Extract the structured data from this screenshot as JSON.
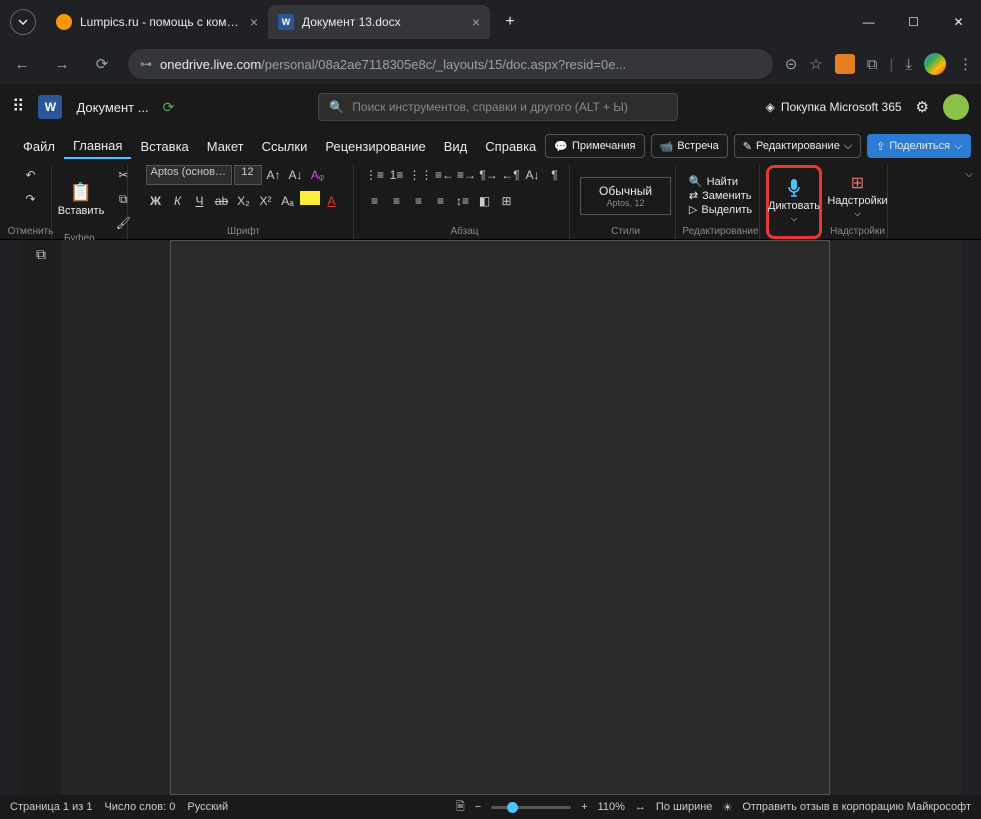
{
  "browser": {
    "tabs": [
      {
        "title": "Lumpics.ru - помощь с компью"
      },
      {
        "title": "Документ 13.docx"
      }
    ],
    "url_host": "onedrive.live.com",
    "url_path": "/personal/08a2ae7118305e8c/_layouts/15/doc.aspx?resid=0e..."
  },
  "app": {
    "doc_name": "Документ ...",
    "search_placeholder": "Поиск инструментов, справки и другого (ALT + Ы)",
    "buy": "Покупка Microsoft 365"
  },
  "menu": {
    "items": [
      "Файл",
      "Главная",
      "Вставка",
      "Макет",
      "Ссылки",
      "Рецензирование",
      "Вид",
      "Справка"
    ],
    "comments": "Примечания",
    "meeting": "Встреча",
    "editing": "Редактирование",
    "share": "Поделиться"
  },
  "ribbon": {
    "undo_label": "Отменить",
    "clipboard": {
      "paste": "Вставить",
      "label": "Буфер обмена"
    },
    "font": {
      "family": "Aptos (основной т...",
      "size": "12",
      "label": "Шрифт"
    },
    "paragraph": {
      "label": "Абзац"
    },
    "styles": {
      "name": "Обычный",
      "sub": "Aptos, 12",
      "label": "Стили"
    },
    "editing": {
      "find": "Найти",
      "replace": "Заменить",
      "select": "Выделить",
      "label": "Редактирование"
    },
    "dictate": {
      "label": "Диктовать"
    },
    "addins": {
      "label": "Надстройки"
    }
  },
  "status": {
    "page": "Страница 1 из 1",
    "words": "Число слов: 0",
    "lang": "Русский",
    "zoom": "110%",
    "fit": "По ширине",
    "feedback": "Отправить отзыв в корпорацию Майкрософт"
  }
}
